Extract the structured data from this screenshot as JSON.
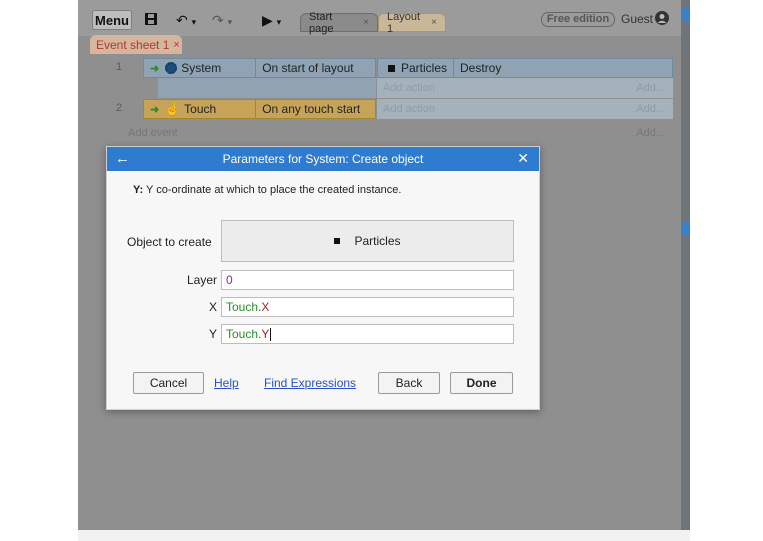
{
  "toolbar": {
    "menu_label": "Menu",
    "tabs": [
      {
        "label": "Start page",
        "close": "×"
      },
      {
        "label": "Layout 1",
        "close": "×"
      }
    ],
    "edition_badge": "Free edition",
    "user_label": "Guest"
  },
  "event_sheet_tab": {
    "label": "Event sheet 1",
    "close": "×"
  },
  "events": [
    {
      "number": "1",
      "condition_object": "System",
      "condition_text": "On start of layout",
      "action_object": "Particles",
      "action_text": "Destroy",
      "add_action": "Add action",
      "add_more": "Add..."
    },
    {
      "number": "2",
      "condition_object": "Touch",
      "condition_text": "On any touch start",
      "add_action": "Add action",
      "add_more": "Add..."
    }
  ],
  "add_event": {
    "label": "Add event",
    "more": "Add..."
  },
  "dialog": {
    "title": "Parameters for System: Create object",
    "description_key": "Y:",
    "description_text": "Y co-ordinate at which to place the created instance.",
    "object_label": "Object to create",
    "object_value": "Particles",
    "layer_label": "Layer",
    "layer_value": "0",
    "x_label": "X",
    "x_value_object": "Touch",
    "x_value_prop": ".X",
    "y_label": "Y",
    "y_value_object": "Touch",
    "y_value_prop": ".Y",
    "cancel_label": "Cancel",
    "help_label": "Help",
    "find_expressions_label": "Find Expressions",
    "back_label": "Back",
    "done_label": "Done"
  },
  "colors": {
    "dialog_title_bar": "#2f7bd0",
    "event1_condition": "#8fa3b3",
    "event2_condition": "#c7a35a",
    "link": "#2a4fc8"
  },
  "icons": [
    "save-icon",
    "undo-icon",
    "redo-icon",
    "play-icon",
    "user-icon",
    "gear-icon",
    "hand-icon",
    "back-arrow-icon",
    "close-icon"
  ]
}
